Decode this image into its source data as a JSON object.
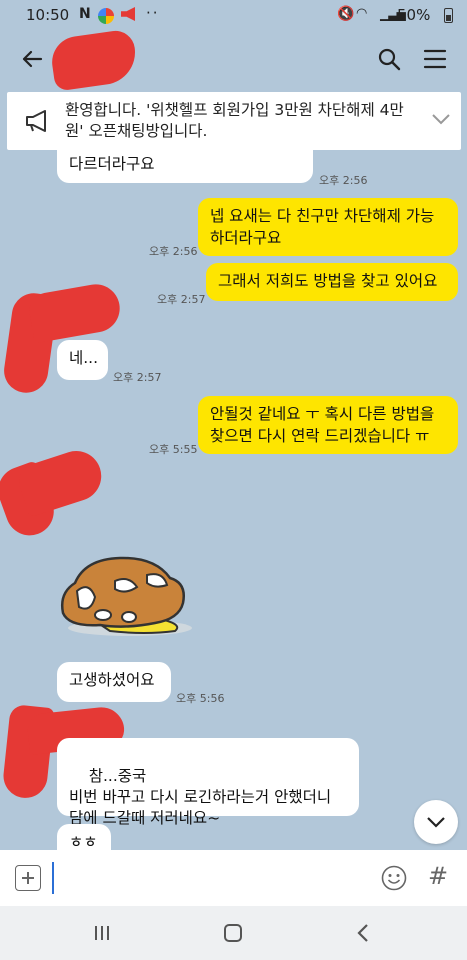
{
  "status_bar": {
    "time": "10:50",
    "n_label": "N",
    "dots": "··",
    "battery": "50%"
  },
  "notice": {
    "text": "환영합니다. '위챗헬프 회원가입 3만원 차단해제 4만원' 오픈채팅방입니다."
  },
  "messages": [
    {
      "dir": "in",
      "text": "다르더라구요",
      "time": "오후 2:56"
    },
    {
      "dir": "out",
      "text": "넵 요새는 다 친구만 차단해제 가능하더라구요",
      "time": "오후 2:56"
    },
    {
      "dir": "out",
      "text": "그래서 저희도 방법을 찾고 있어요",
      "time": "오후 2:57"
    },
    {
      "dir": "in",
      "text": "네...",
      "time": "오후 2:57"
    },
    {
      "dir": "out",
      "text": "안될것 같네요 ㅜ 혹시 다른 방법을 찾으면 다시 연락 드리겠습니다 ㅠ",
      "time": "오후 5:55"
    },
    {
      "dir": "in",
      "text": "고생하셨어요",
      "time": "오후 5:56"
    },
    {
      "dir": "in",
      "text": "참...중국\n비번 바꾸고 다시 로긴하라는거 안했더니 담에 드갈때 저러네요~",
      "time": ""
    },
    {
      "dir": "in",
      "text": "ㅎㅎ",
      "time": ""
    }
  ],
  "icons": {
    "back": "arrow-left-icon",
    "search": "search-icon",
    "menu": "hamburger-menu-icon",
    "notice": "megaphone-icon",
    "expand": "chevron-down-icon",
    "attach": "plus-box-icon",
    "emoji": "smiley-icon",
    "hash": "#"
  },
  "colors": {
    "background": "#b2c7d9",
    "outgoing_bubble": "#fee500",
    "incoming_bubble": "#ffffff",
    "redaction": "#e53935"
  }
}
